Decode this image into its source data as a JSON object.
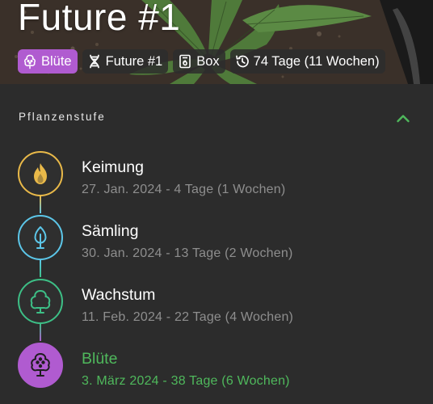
{
  "header": {
    "title": "Future #1",
    "chips": [
      {
        "label": "Blüte",
        "icon": "flower-tree-icon"
      },
      {
        "label": "Future #1",
        "icon": "dna-icon"
      },
      {
        "label": "Box",
        "icon": "grow-box-icon"
      },
      {
        "label": "74 Tage (11 Wochen)",
        "icon": "history-icon"
      }
    ]
  },
  "section": {
    "title": "Pflanzenstufe",
    "toggle_icon": "chevron-up-icon"
  },
  "stages": [
    {
      "name": "Keimung",
      "meta": "27. Jan. 2024 - 4 Tage (1 Wochen)",
      "icon": "flame-seed-icon",
      "color": "#e9b949"
    },
    {
      "name": "Sämling",
      "meta": "30. Jan. 2024 - 13 Tage (2 Wochen)",
      "icon": "seedling-leaf-icon",
      "color": "#5cc6e8"
    },
    {
      "name": "Wachstum",
      "meta": "11. Feb. 2024 - 22 Tage (4 Wochen)",
      "icon": "tree-icon",
      "color": "#3dbf86"
    },
    {
      "name": "Blüte",
      "meta": "3. März 2024 - 38 Tage (6 Wochen)",
      "icon": "flower-tree-icon",
      "color": "#b05bd0"
    }
  ],
  "colors": {
    "background": "#2c2c2c",
    "accent_green": "#4fb85c",
    "chip_active": "#b05bd0",
    "muted_text": "#8e8e8e"
  }
}
